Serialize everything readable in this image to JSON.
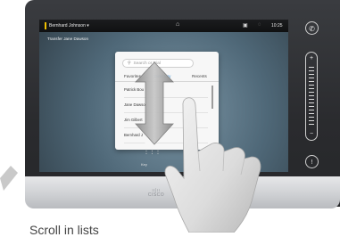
{
  "topbar": {
    "user_label": "Bernhard Johnson",
    "user_caret": "▾",
    "home_glyph": "⌂",
    "camera_glyph": "▣",
    "mute_glyph": "◌",
    "time": "10:25"
  },
  "screen": {
    "subtitle": "Transfer Jane Dawson"
  },
  "panel": {
    "search_icon": "search-icon",
    "search_placeholder": "Search or Dial",
    "tabs": [
      {
        "label": "Favorites",
        "active": false
      },
      {
        "label": "Directory",
        "active": true
      },
      {
        "label": "Recents",
        "active": false
      }
    ],
    "rows": [
      {
        "name": "Patrick Bou"
      },
      {
        "name": "Jane Dawso"
      },
      {
        "name": "Jim Gilbert"
      },
      {
        "name": "Bernhard J"
      }
    ]
  },
  "keypad": {
    "glyph": "⋮⋮⋮",
    "label": "Key"
  },
  "side_controls": {
    "top_icon": "phone-icon",
    "top_glyph": "✆",
    "vol_plus": "+",
    "vol_minus": "−",
    "bottom_glyph": "!"
  },
  "brand": {
    "name": "CISCO",
    "dots": "ıı|ıı"
  },
  "caption": {
    "text": "Scroll in lists"
  },
  "colors": {
    "accent_yellow": "#f0c000",
    "active_tab_blue": "#3a8fd6",
    "screen_teal": "#5f7a8a"
  }
}
